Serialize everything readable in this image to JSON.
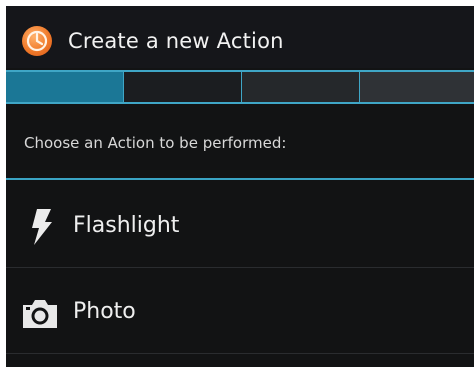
{
  "header": {
    "title": "Create a new Action",
    "app_icon": "app-logo-icon"
  },
  "wizard": {
    "steps": [
      {
        "state": "active"
      },
      {
        "state": "inactive"
      },
      {
        "state": "inactive"
      },
      {
        "state": "inactive"
      }
    ],
    "accent_color": "#3aa4c4"
  },
  "prompt": "Choose an Action to be performed:",
  "actions": [
    {
      "label": "Flashlight",
      "icon": "flashlight-bolt-icon"
    },
    {
      "label": "Photo",
      "icon": "camera-icon"
    }
  ]
}
